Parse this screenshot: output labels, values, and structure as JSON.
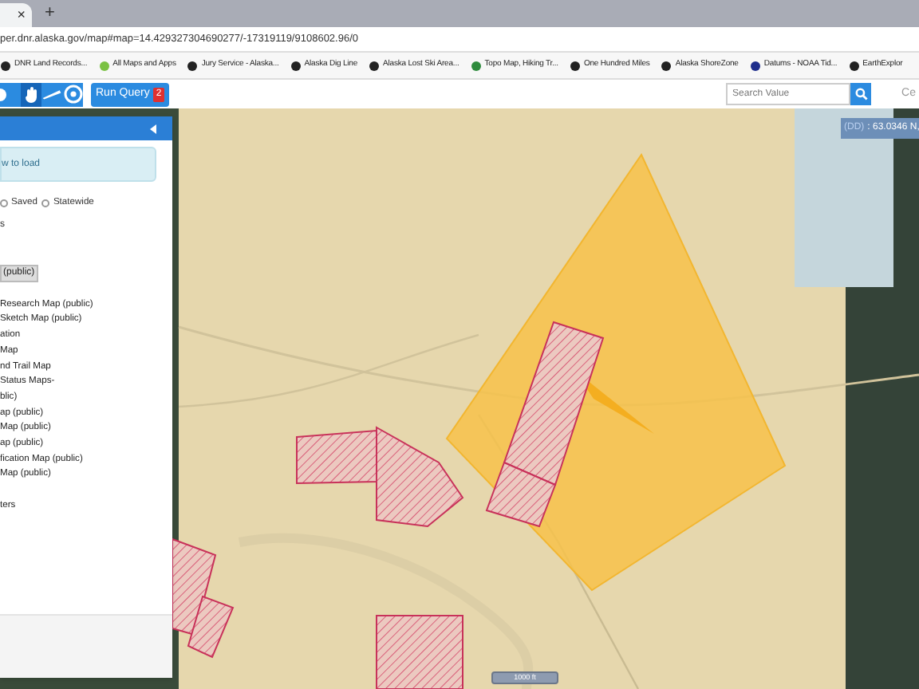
{
  "browser": {
    "tab_close": "×",
    "new_tab": "+",
    "url": "per.dnr.alaska.gov/map#map=14.429327304690277/-17319119/9108602.96/0",
    "bookmarks": [
      {
        "label": "DNR Land Records..."
      },
      {
        "label": "All Maps and Apps"
      },
      {
        "label": "Jury Service - Alaska..."
      },
      {
        "label": "Alaska Dig Line"
      },
      {
        "label": "Alaska Lost Ski Area..."
      },
      {
        "label": "Topo Map, Hiking Tr..."
      },
      {
        "label": "One Hundred Miles"
      },
      {
        "label": "Alaska ShoreZone"
      },
      {
        "label": "Datums - NOAA Tid..."
      },
      {
        "label": "EarthExplor"
      }
    ]
  },
  "toolbar": {
    "tools": [
      {
        "kind": "dot",
        "selected": false
      },
      {
        "kind": "hand",
        "selected": true
      },
      {
        "kind": "ruler",
        "selected": false
      },
      {
        "kind": "target",
        "selected": false
      }
    ],
    "run_query": "Run Query",
    "query_count": "2",
    "search": {
      "placeholder": "Search Value"
    },
    "cut_link": "Ce"
  },
  "sidebar": {
    "notice": "w to load",
    "options": [
      {
        "label": "Saved",
        "selected": false
      },
      {
        "label": "Statewide",
        "selected": false
      }
    ],
    "section": "s",
    "selected_map": "(public)",
    "maps": [
      "Research Map (public)",
      "Sketch Map (public)",
      "ation",
      "Map",
      "nd Trail Map",
      "Status Maps-",
      "blic)",
      "ap (public)",
      "Map (public)",
      "ap (public)",
      "fication Map (public)",
      "Map (public)"
    ],
    "footer_item": "ters"
  },
  "map": {
    "coordinates": {
      "label": "(DD)",
      "value": ": 63.0346 N,"
    },
    "scale": "1000 ft"
  }
}
